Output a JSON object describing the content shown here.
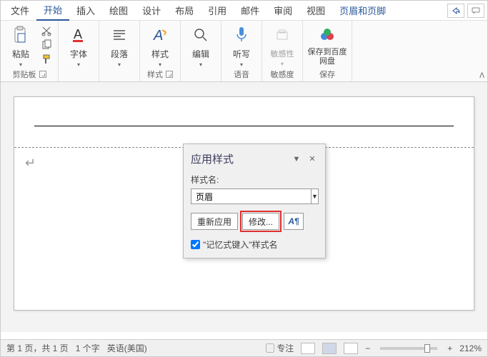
{
  "tabs": {
    "file": "文件",
    "home": "开始",
    "insert": "插入",
    "draw": "绘图",
    "design": "设计",
    "layout": "布局",
    "ref": "引用",
    "mail": "邮件",
    "review": "审阅",
    "view": "视图",
    "hf": "页眉和页脚"
  },
  "ribbon": {
    "clipboard": {
      "paste": "粘贴",
      "label": "剪贴板"
    },
    "font": {
      "label": "字体"
    },
    "para": {
      "label": "段落"
    },
    "styles": {
      "btn": "样式",
      "label": "样式"
    },
    "edit": {
      "btn": "编辑"
    },
    "dictate": {
      "btn": "听写",
      "label": "语音"
    },
    "sens": {
      "btn": "敏感性",
      "label": "敏感度"
    },
    "save": {
      "btn": "保存到百度网盘",
      "label": "保存"
    }
  },
  "pane": {
    "title": "应用样式",
    "styleNameLabel": "样式名:",
    "styleValue": "页眉",
    "reapply": "重新应用",
    "modify": "修改...",
    "autocomplete": "\"记忆式键入\"样式名"
  },
  "status": {
    "page": "第 1 页，共 1 页",
    "words": "1 个字",
    "lang": "英语(美国)",
    "focus": "专注",
    "zoom": "212%"
  }
}
